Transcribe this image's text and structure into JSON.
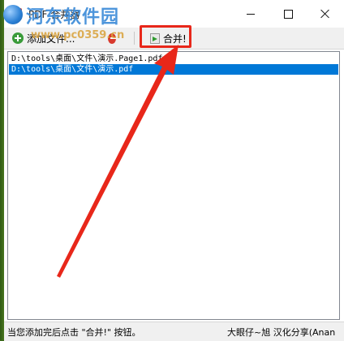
{
  "window": {
    "title": "PDF 合并器"
  },
  "toolbar": {
    "add_label": "添加文件...",
    "merge_label": "合并!"
  },
  "file_list": [
    {
      "path": "D:\\tools\\桌面\\文件\\演示.Page1.pdf",
      "selected": false
    },
    {
      "path": "D:\\tools\\桌面\\文件\\演示.pdf",
      "selected": true
    }
  ],
  "status": {
    "left": "当您添加完后点击 \"合并!\" 按钮。",
    "right": "大眼仔~旭 汉化分享(Anan"
  },
  "watermark": {
    "site": "河东软件园",
    "url": "www.pc0359.cn"
  },
  "colors": {
    "selection": "#0078d7",
    "annotation": "#e8271a"
  }
}
